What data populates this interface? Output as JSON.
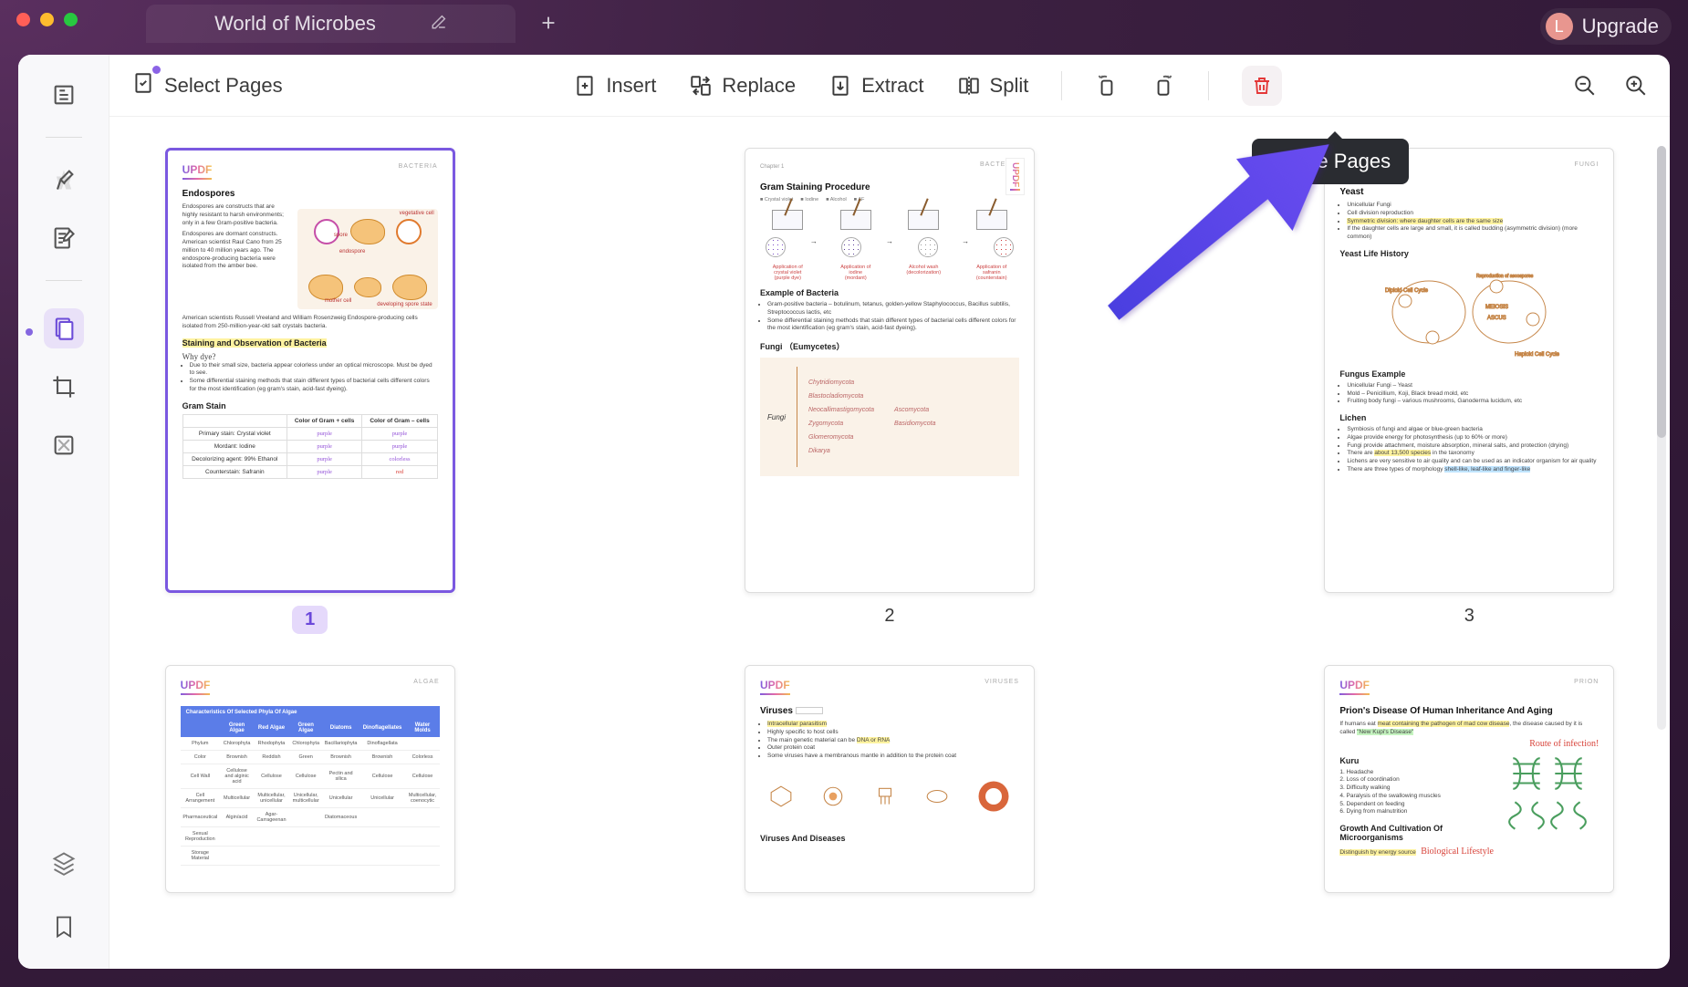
{
  "window": {
    "tab_title": "World of Microbes",
    "avatar_letter": "L",
    "upgrade_label": "Upgrade"
  },
  "toolbar": {
    "select_pages": "Select Pages",
    "insert": "Insert",
    "replace": "Replace",
    "extract": "Extract",
    "split": "Split",
    "delete_tooltip": "Delete Pages"
  },
  "pages": {
    "p1": {
      "num": "1",
      "category": "BACTERIA",
      "h_endospores": "Endospores",
      "endo_para1": "Endospores are constructs that are highly resistant to harsh environments; only in a few Gram-positive bacteria.",
      "endo_para2": "Endospores are dormant constructs. American scientist Raul Cano from 25 million to 40 million years ago. The endospore-producing bacteria were isolated from the amber bee.",
      "endo_para3": "American scientists Russell Vreeland and William Rosenzweig Endospore-producing cells isolated from 250-million-year-old salt crystals bacteria.",
      "h_stain": "Staining and Observation of Bacteria",
      "why_dye": "Why dye?",
      "dye1": "Due to their small size, bacteria appear colorless under an optical microscope. Must be dyed to see.",
      "dye2": "Some differential staining methods that stain different types of bacterial cells different colors for the most identification (eg gram's stain, acid-fast dyeing).",
      "h_gram": "Gram Stain",
      "tbl": {
        "c1": "Color of Gram + cells",
        "c2": "Color of Gram – cells",
        "r1": "Primary stain: Crystal violet",
        "r2": "Mordant: Iodine",
        "r3": "Decolorizing agent: 99% Ethanol",
        "r4": "Counterstain: Safranin",
        "purple": "purple",
        "colorless": "colorless",
        "red": "red"
      },
      "dlabels": {
        "a": "vegetative cell",
        "b": "spore",
        "c": "endospore",
        "d": "mother cell",
        "e": "developing spore state"
      }
    },
    "p2": {
      "num": "2",
      "category": "BACTERIA",
      "chapter": "Chapter 1",
      "h_proc": "Gram Staining Procedure",
      "legend": {
        "a": "Crystal violet",
        "b": "Iodine",
        "c": "Alcohol",
        "d": "AF"
      },
      "steps": {
        "s1": "Application of crystal violet (purple dye)",
        "s2": "Application of iodine (mordant)",
        "s3": "Alcohol wash (decolorization)",
        "s4": "Application of safranin (counterstain)"
      },
      "h_ex": "Example of Bacteria",
      "ex1": "Gram-positive bacteria – botulinum, tetanus, golden-yellow Staphylococcus, Bacillus subtilis, Streptococcus lactis, etc",
      "ex2": "Some differential staining methods that stain different types of bacterial cells different colors for the most identification (eg gram's stain, acid-fast dyeing).",
      "h_fungi": "Fungi （Eumycetes）",
      "taxa": [
        "Chytridiomycota",
        "Blastocladiomycota",
        "Neocallimastigomycota",
        "Zygomycota",
        "Glomeromycota",
        "Dikarya",
        "Ascomycota",
        "Basidiomycota"
      ],
      "fungi_label": "Fungi"
    },
    "p3": {
      "num": "3",
      "category": "FUNGI",
      "h_yeast": "Yeast",
      "y1": "Unicellular Fungi",
      "y2": "Cell division reproduction",
      "y3": "Symmetric division: where daughter cells are the same size",
      "y4": "If the daughter cells are large and small, it is called budding (asymmetric division) (more common)",
      "h_life": "Yeast Life History",
      "h_fex": "Fungus Example",
      "f1": "Unicellular Fungi – Yeast",
      "f2": "Mold – Penicillium, Koji, Black bread mold, etc",
      "f3": "Fruiting body fungi – various mushrooms, Ganoderma lucidum, etc",
      "h_lichen": "Lichen",
      "l1": "Symbiosis of fungi and algae or blue-green bacteria",
      "l2": "Algae provide energy for photosynthesis (up to 60% or more)",
      "l3": "Fungi provide attachment, moisture absorption, mineral salts, and protection (drying)",
      "l4a": "There are ",
      "l4b": "about 13,500 species",
      "l4c": " in the taxonomy",
      "l5": "Lichens are very sensitive to air quality and can be used as an indicator organism for air quality",
      "l6a": "There are three types of morphology ",
      "l6b": "shell-like, leaf-like and finger-like",
      "cycle": {
        "a": "Diploid Cell Cycle",
        "b": "Haploid Cell Cycle",
        "c": "MEIOSIS",
        "d": "ASCUS",
        "e": "Reproduction of ascospores"
      }
    },
    "p4": {
      "category": "ALGAE",
      "h_char": "Characteristics Of Selected Phyla Of Algae",
      "cols": [
        "",
        "Green Algae",
        "Red Algae",
        "Green Algae",
        "Diatoms",
        "Dinoflagellates",
        "Water Molds"
      ],
      "rows": [
        [
          "Phylum",
          "Chlorophyta",
          "Rhodophyta",
          "Chlorophyta",
          "Bacillariophyta",
          "Dinoflagellata",
          ""
        ],
        [
          "Color",
          "Brownish",
          "Reddish",
          "Green",
          "Brownish",
          "Brownish",
          "Colorless"
        ],
        [
          "Cell Wall",
          "Cellulose and alginic acid",
          "Cellulose",
          "Cellulose",
          "Pectin and silica",
          "Cellulose",
          "Cellulose"
        ],
        [
          "Cell Arrangement",
          "Multicellular",
          "Multicellular, unicellular",
          "Unicellular, multicellular",
          "Unicellular",
          "Unicellular",
          "Multicellular, coenocytic"
        ],
        [
          "Pharmaceutical",
          "Algin/acid",
          "Agar-Carrageenan",
          "",
          "Diatomaceous",
          "",
          ""
        ],
        [
          "Sexual Reproduction",
          "",
          "",
          "",
          "",
          "",
          ""
        ],
        [
          "Storage Material",
          "",
          "",
          "",
          "",
          "",
          ""
        ]
      ]
    },
    "p5": {
      "category": "VIRUSES",
      "h_vir": "Viruses",
      "v1": "Intracellular parasitism",
      "v2": "Highly specific to host cells",
      "v3a": "The main genetic material can be ",
      "v3b": "DNA or RNA",
      "v4": "Outer protein coat",
      "v5": "Some viruses have a membranous mantle in addition to the protein coat",
      "h_vd": "Viruses And Diseases"
    },
    "p6": {
      "category": "PRION",
      "h_prion": "Prion's Disease Of Human Inheritance And Aging",
      "p1a": "If humans eat ",
      "p1b": "meat containing the pathogen of mad cow disease",
      "p1c": ", the disease caused by it is called ",
      "p1d": "\"New Kupi's Disease\"",
      "route": "Route of infection!",
      "h_kuru": "Kuru",
      "k": [
        "1. Headache",
        "2. Loss of coordination",
        "3. Difficulty walking",
        "4. Paralysis of the swallowing muscles",
        "5. Dependent on feeding",
        "6. Dying from malnutrition"
      ],
      "h_grow": "Growth And Cultivation Of Microorganisms",
      "g1": "Distinguish by energy source",
      "g2": "Biological Lifestyle"
    }
  }
}
